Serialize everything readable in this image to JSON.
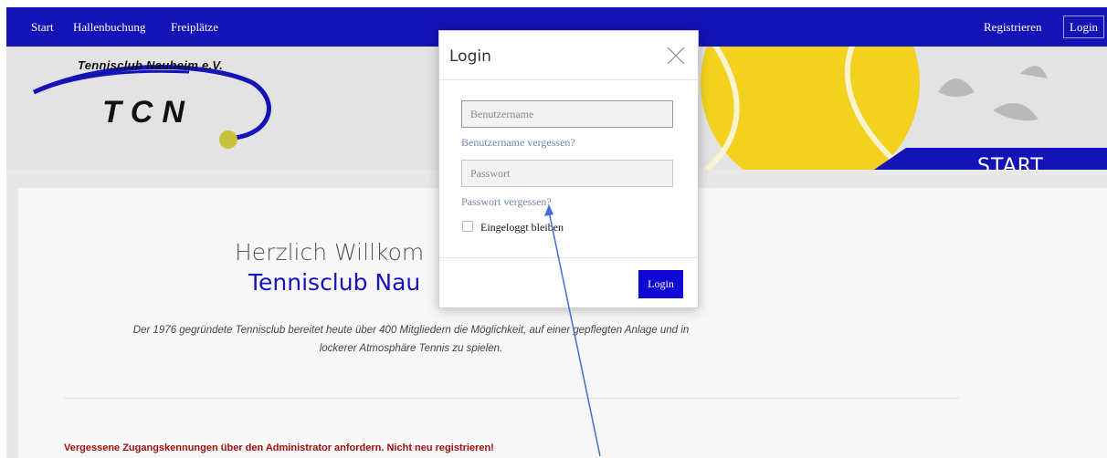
{
  "nav": {
    "items": [
      "Start",
      "Hallenbuchung",
      "Freiplätze"
    ],
    "register_label": "Registrieren",
    "login_label": "Login"
  },
  "header": {
    "club_name": "Tennisclub Nauheim e.V.",
    "logo_abbr": "TCN",
    "section_label": "START"
  },
  "main": {
    "welcome_line1": "Herzlich Willkom",
    "welcome_line2": "Tennisclub Nau",
    "intro_line1": "Der 1976 gegründete Tennisclub bereitet heute über 400 Mitgliedern die Möglichkeit, auf einer gepflegten Anlage und in",
    "intro_line2": "lockerer Atmosphäre Tennis zu spielen.",
    "notice": "Vergessene Zugangskennungen über den Administrator anfordern. Nicht neu registrieren!"
  },
  "login_modal": {
    "title": "Login",
    "username_placeholder": "Benutzername",
    "forgot_username": "Benutzername vergessen?",
    "password_placeholder": "Passwort",
    "forgot_password": "Passwort vergessen?",
    "remember_me": "Eingeloggt bleiben",
    "submit_label": "Login"
  },
  "colors": {
    "brand_blue": "#1413b8",
    "button_blue": "#1208d6",
    "notice_red": "#a00f0f",
    "ball_yellow": "#f2d21e",
    "annotation_arrow": "#3e6fd1"
  },
  "icons": {
    "close": "close-icon",
    "logo_ball": "tennis-ball-icon"
  }
}
